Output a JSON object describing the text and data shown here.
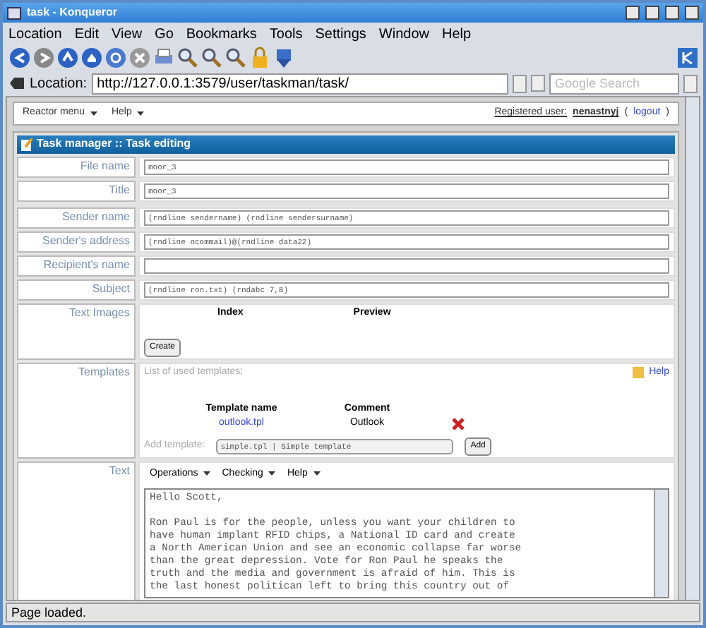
{
  "window": {
    "title": "task - Konqueror"
  },
  "menu": [
    "Location",
    "Edit",
    "View",
    "Go",
    "Bookmarks",
    "Tools",
    "Settings",
    "Window",
    "Help"
  ],
  "location_bar": {
    "label": "Location:",
    "url": "http://127.0.0.1:3579/user/taskman/task/",
    "search_placeholder": "Google Search"
  },
  "page_menu": {
    "items": [
      "Reactor menu",
      "Help"
    ],
    "user_label": "Registered user:",
    "user": "nenastnyj",
    "logout_open": "(",
    "logout": "logout",
    "logout_close": ")"
  },
  "panel": {
    "title": "Task manager :: Task editing"
  },
  "fields": [
    {
      "label": "File name",
      "value": "moor_3"
    },
    {
      "label": "Title",
      "value": "moor_3"
    },
    {
      "label": "Sender name",
      "value": "(rndline sendername) (rndline sendersurname)"
    },
    {
      "label": "Sender's address",
      "value": "(rndline ncommail)@(rndline data22)"
    },
    {
      "label": "Recipient's name"
    },
    {
      "label": "Subject",
      "value": "(rndline ron.txt) (rndabc 7,8)"
    }
  ],
  "text_images": {
    "label": "Text Images",
    "columns": [
      "Index",
      "Preview"
    ],
    "button": "Create"
  },
  "templates": {
    "label": "Templates",
    "intro": "List of used templates:",
    "help": "Help",
    "columns": [
      "Template name",
      "Comment"
    ],
    "rows": [
      {
        "name": "outlook.tpl",
        "comment": "Outlook"
      }
    ],
    "add_label": "Add template:",
    "add_value": "simple.tpl | Simple template",
    "add_button": "Add"
  },
  "text": {
    "label": "Text",
    "menus": [
      "Operations",
      "Checking",
      "Help"
    ],
    "greeting": "Hello Scott,",
    "lines": [
      "Ron Paul is for the people, unless you want your children to",
      "have human implant RFID chips, a National ID card and create",
      "a North American Union and see an economic collapse far worse",
      "than the great depression. Vote for Ron Paul he speaks the",
      "truth and the media and government is afraid of him. This is",
      "the last honest politican left to bring this country out of"
    ]
  },
  "status_bar": "Page loaded."
}
